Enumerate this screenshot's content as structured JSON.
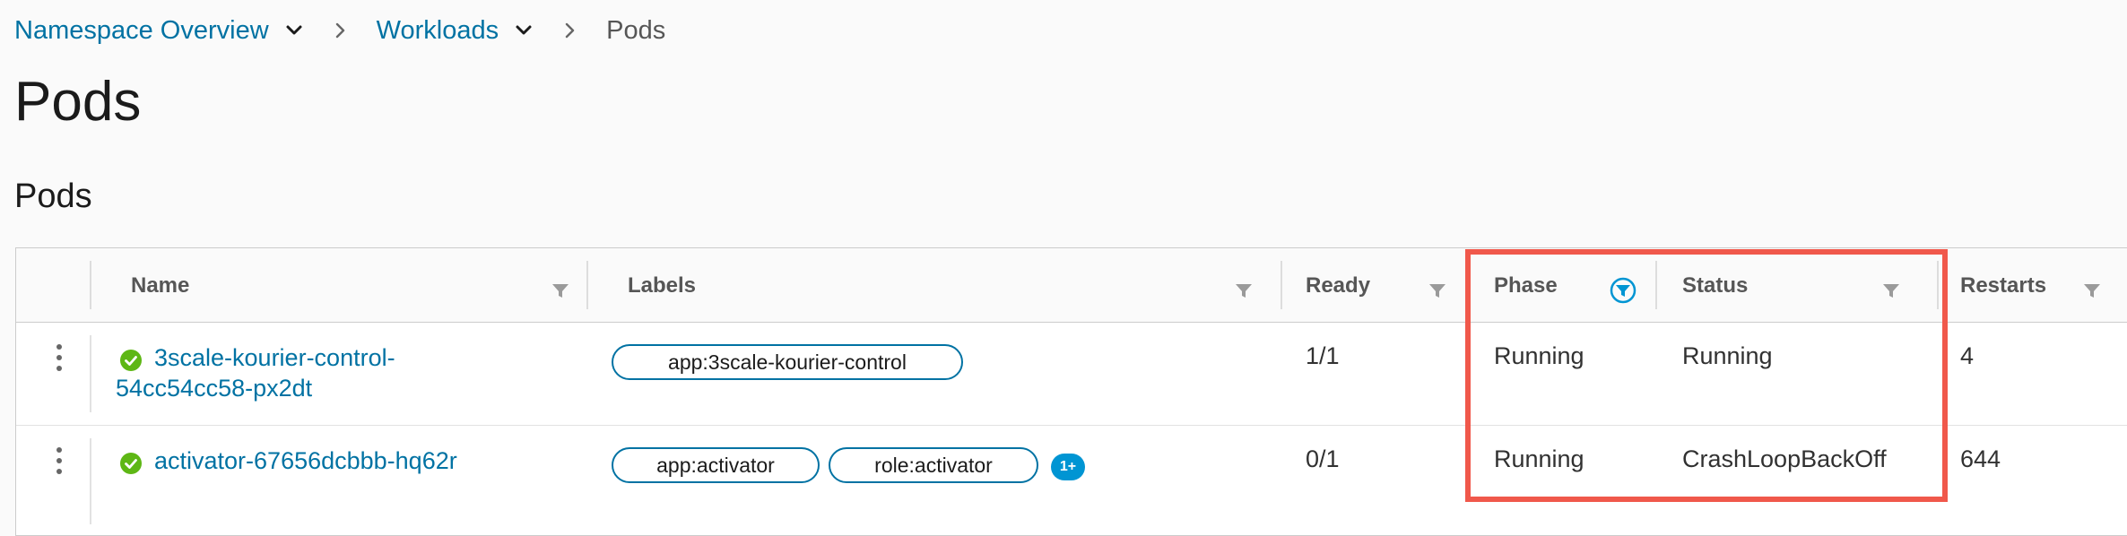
{
  "breadcrumb": {
    "items": [
      {
        "label": "Namespace Overview"
      },
      {
        "label": "Workloads"
      },
      {
        "label": "Pods"
      }
    ]
  },
  "page_title": "Pods",
  "section_title": "Pods",
  "table": {
    "columns": [
      {
        "label": "Name",
        "filter_active": false
      },
      {
        "label": "Labels",
        "filter_active": false
      },
      {
        "label": "Ready",
        "filter_active": false
      },
      {
        "label": "Phase",
        "filter_active": true
      },
      {
        "label": "Status",
        "filter_active": false
      },
      {
        "label": "Restarts",
        "filter_active": false
      }
    ],
    "rows": [
      {
        "name_line1": "3scale-kourier-control-",
        "name_line2": "54cc54cc58-px2dt",
        "labels": [
          "app:3scale-kourier-control"
        ],
        "more_labels": "",
        "ready": "1/1",
        "phase": "Running",
        "status": "Running",
        "restarts": "4"
      },
      {
        "name_line1": "activator-67656dcbbb-hq62r",
        "name_line2": "",
        "labels": [
          "app:activator",
          "role:activator"
        ],
        "more_labels": "1+",
        "ready": "0/1",
        "phase": "Running",
        "status": "CrashLoopBackOff",
        "restarts": "644"
      }
    ]
  },
  "colors": {
    "link": "#0072a3",
    "highlight": "#f0584b",
    "success": "#5eb715",
    "badge": "#0095d3"
  },
  "icons": {
    "breadcrumb_caret": "chevron-down-icon",
    "breadcrumb_separator": "chevron-right-icon",
    "column_filter": "filter-icon",
    "row_actions": "more-vertical-icon",
    "pod_status": "check-circle-icon"
  }
}
